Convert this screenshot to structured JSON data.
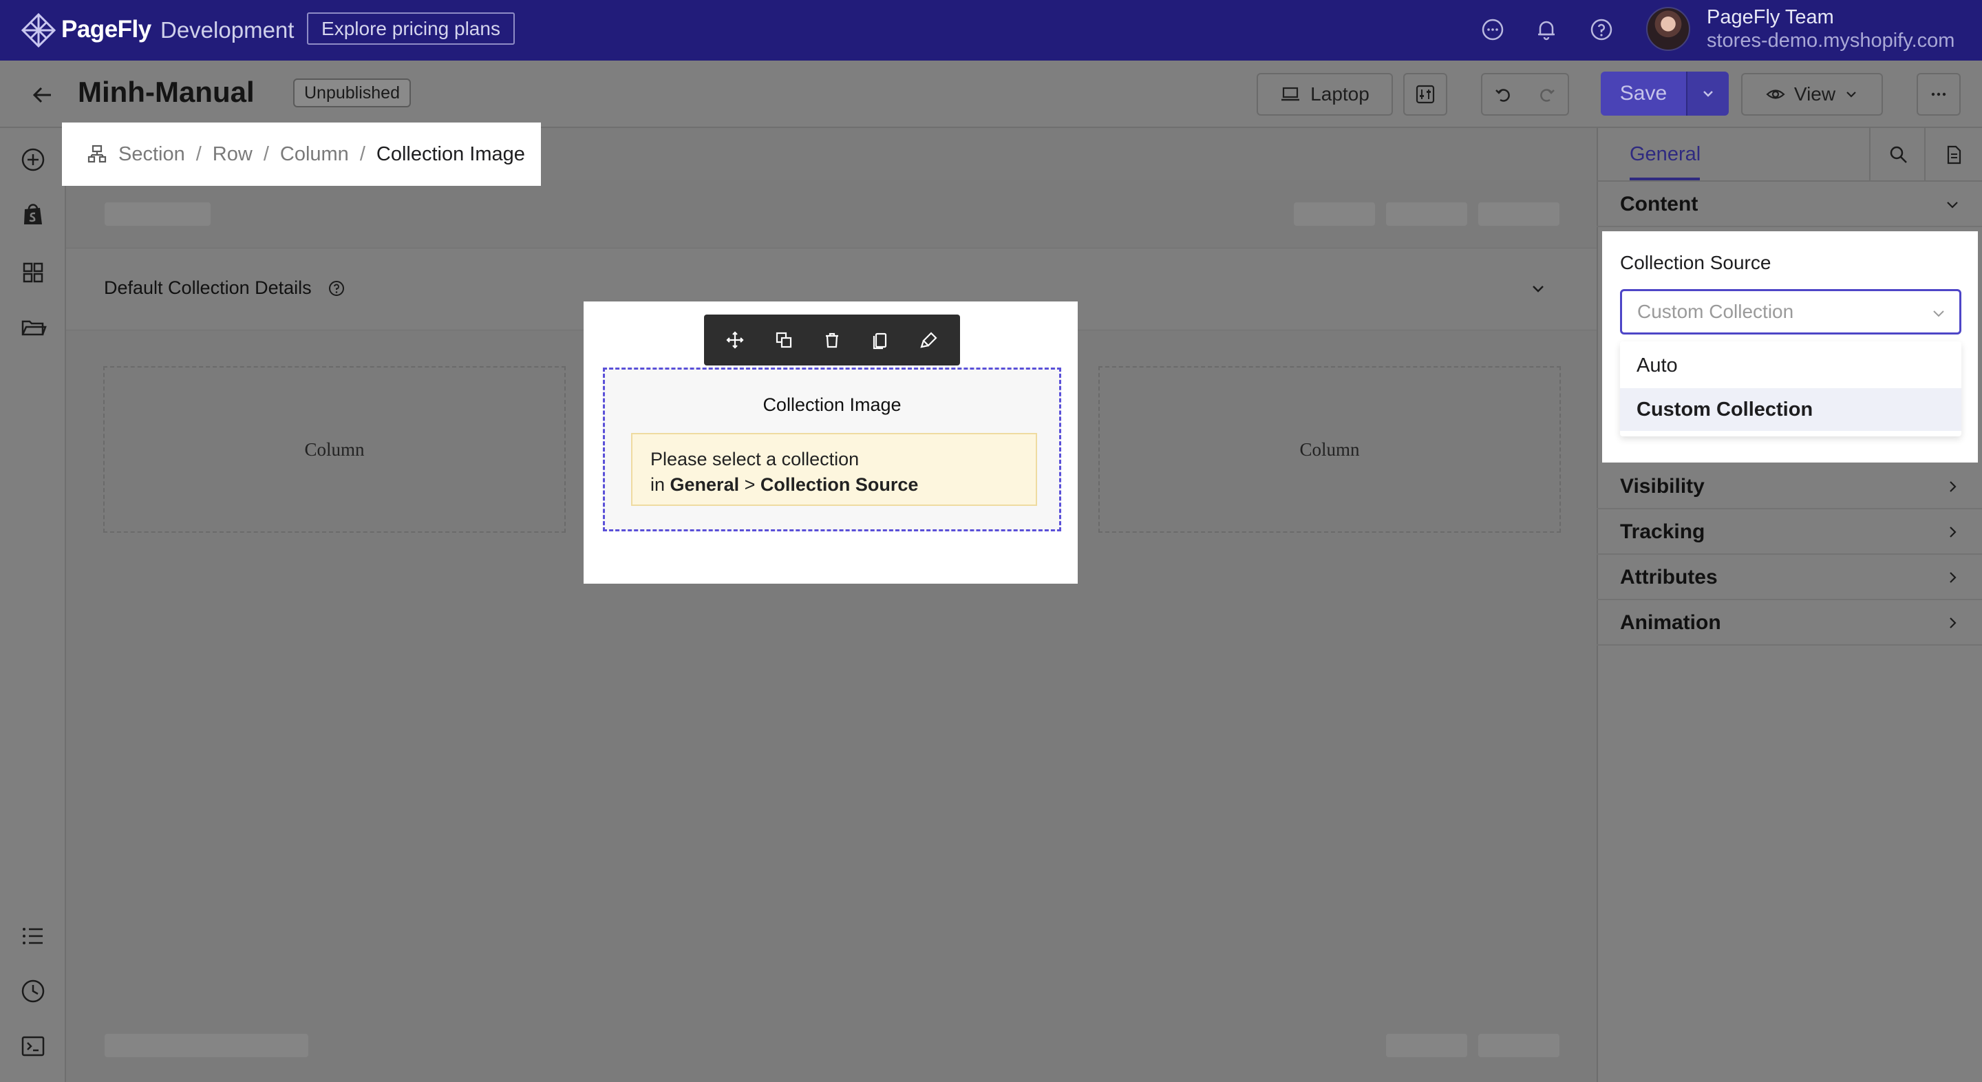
{
  "topbar": {
    "brand": "PageFly",
    "env": "Development",
    "pricing_button": "Explore pricing plans",
    "team_name": "PageFly Team",
    "store_domain": "stores-demo.myshopify.com"
  },
  "header": {
    "page_title": "Minh-Manual",
    "status": "Unpublished",
    "device": "Laptop",
    "save": "Save",
    "view": "View"
  },
  "breadcrumb": {
    "items": [
      "Section",
      "Row",
      "Column",
      "Collection Image"
    ],
    "separator": "/"
  },
  "canvas": {
    "section_label": "Default Collection Details",
    "column_left": "Column",
    "column_right": "Column",
    "element_title": "Collection Image",
    "notice_line1": "Please select a collection",
    "notice_prefix": "in",
    "notice_general": "General",
    "notice_gt": ">",
    "notice_source": "Collection Source"
  },
  "panel": {
    "tab_general": "General",
    "content": "Content",
    "collection_source_label": "Collection Source",
    "select_value": "Custom Collection",
    "options": [
      "Auto",
      "Custom Collection"
    ],
    "sections": [
      "Visibility",
      "Tracking",
      "Attributes",
      "Animation"
    ]
  },
  "colors": {
    "topbar_bg": "#221c7a",
    "accent": "#4e46c7",
    "save_button": "#4a43b6",
    "overlay_gray": "#7f7f7f",
    "notice_bg": "#fdf6de"
  },
  "icons": [
    "pagefly-logo-icon",
    "chat-icon",
    "bell-icon",
    "help-icon",
    "back-arrow-icon",
    "laptop-icon",
    "sliders-icon",
    "undo-icon",
    "redo-icon",
    "chevron-down-icon",
    "eye-icon",
    "more-icon",
    "plus-circle-icon",
    "shopify-bag-icon",
    "grid-icon",
    "folder-icon",
    "list-icon",
    "clock-icon",
    "terminal-icon",
    "hierarchy-icon",
    "move-icon",
    "duplicate-icon",
    "trash-icon",
    "copy-icon",
    "paint-icon",
    "search-icon",
    "page-icon",
    "chevron-right-icon",
    "question-circle-icon"
  ]
}
